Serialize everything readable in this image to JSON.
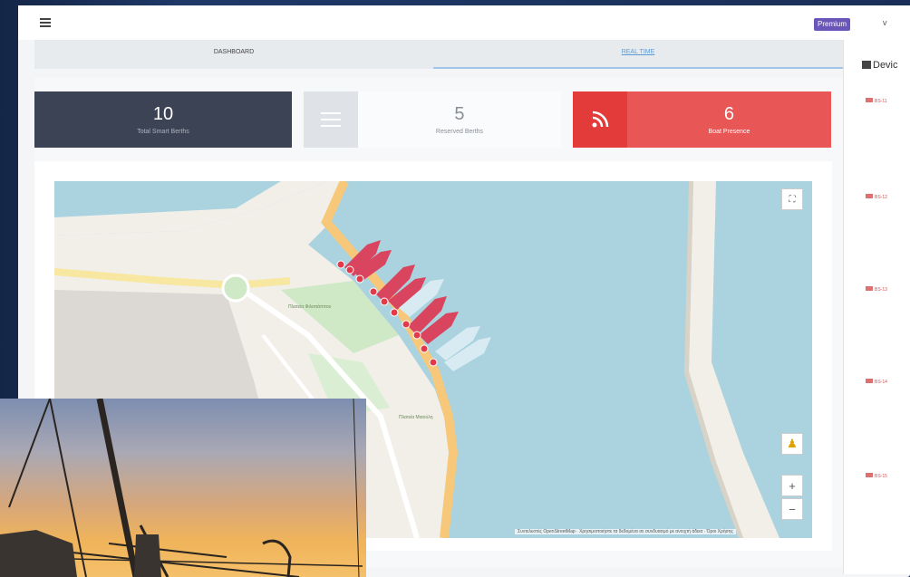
{
  "header": {
    "badge": "Premium",
    "user_menu": "v"
  },
  "tabs": [
    {
      "label": "DASHBOARD"
    },
    {
      "label": "REAL TIME",
      "active": true
    }
  ],
  "cards": [
    {
      "value": "10",
      "label": "Total Smart Berths",
      "color": "#3c4354"
    },
    {
      "value": "5",
      "label": "Reserved Berths",
      "color": "#fafbfc"
    },
    {
      "value": "6",
      "label": "Boat Presence",
      "color": "#e85656",
      "icon": "wifi-signal-icon"
    }
  ],
  "map": {
    "attribution": "Συντελεστές OpenStreetMap · Χρησιμοποιήστε τα δεδομένα σε συνδυασμό με ανοιχτή άδεια · Όροι Χρήσης",
    "labels": [
      "Πλατεία Φιλοπάππου",
      "Πλατεία Μιαούλη"
    ],
    "zoom_in": "+",
    "zoom_out": "−"
  },
  "side_panel": {
    "title": "Devic",
    "items": [
      "BS-11",
      "BS-12",
      "BS-13",
      "BS-14",
      "BS-15"
    ]
  },
  "colors": {
    "accent": "#5a9bd5",
    "danger": "#e85656",
    "dark": "#3c4354"
  }
}
